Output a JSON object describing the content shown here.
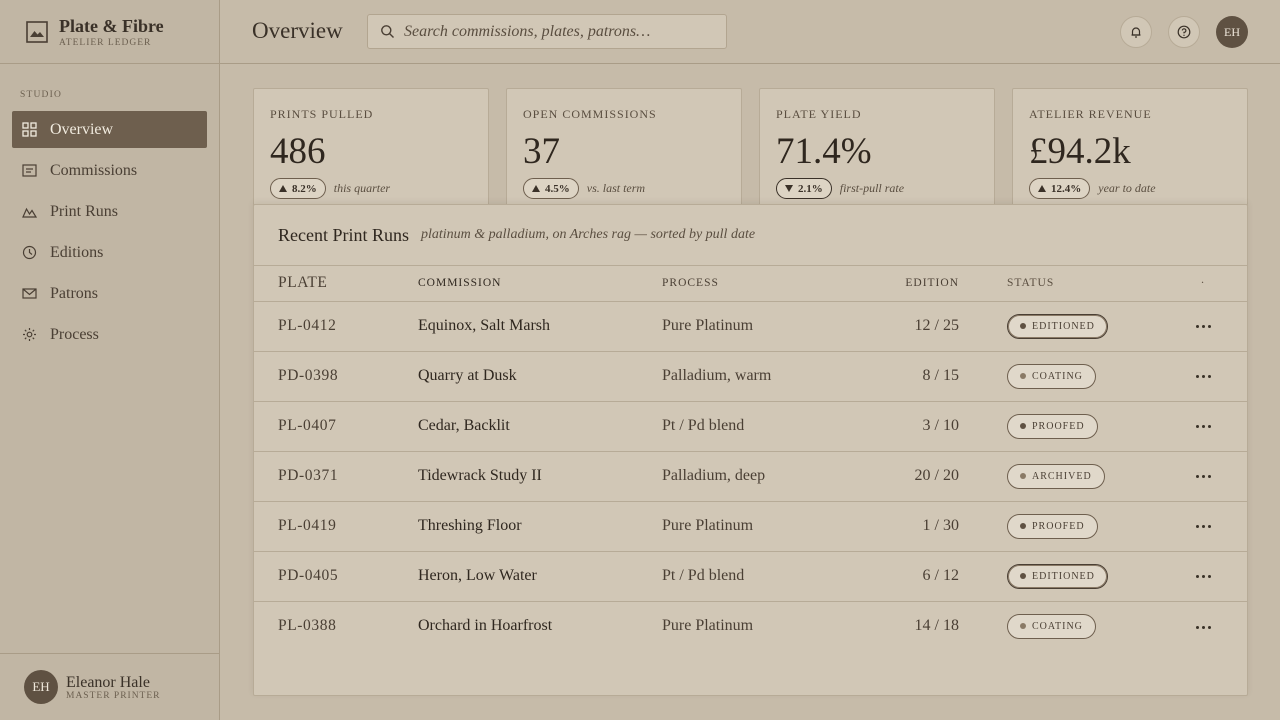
{
  "brand": {
    "name": "Plate & Fibre",
    "subtitle": "ATELIER LEDGER"
  },
  "sidebar": {
    "section_label": "STUDIO",
    "items": [
      {
        "label": "Overview",
        "icon": "grid-icon",
        "active": true
      },
      {
        "label": "Commissions",
        "icon": "list-doc-icon",
        "active": false
      },
      {
        "label": "Print Runs",
        "icon": "mountain-icon",
        "active": false
      },
      {
        "label": "Editions",
        "icon": "clock-icon",
        "active": false
      },
      {
        "label": "Patrons",
        "icon": "envelope-icon",
        "active": false
      },
      {
        "label": "Process",
        "icon": "gear-icon",
        "active": false
      }
    ]
  },
  "user": {
    "initials": "EH",
    "name": "Eleanor Hale",
    "role": "MASTER PRINTER"
  },
  "header": {
    "title": "Overview",
    "search_placeholder": "Search commissions, plates, patrons…",
    "avatar_initials": "EH"
  },
  "kpis": [
    {
      "label": "PRINTS PULLED",
      "value": "486",
      "delta": "8.2%",
      "direction": "up",
      "note": "this quarter"
    },
    {
      "label": "OPEN COMMISSIONS",
      "value": "37",
      "delta": "4.5%",
      "direction": "up",
      "note": "vs. last term"
    },
    {
      "label": "PLATE YIELD",
      "value": "71.4%",
      "delta": "2.1%",
      "direction": "down",
      "note": "first-pull rate"
    },
    {
      "label": "ATELIER REVENUE",
      "value": "£94.2k",
      "delta": "12.4%",
      "direction": "up",
      "note": "year to date"
    }
  ],
  "table": {
    "title": "Recent Print Runs",
    "subtitle": "platinum & palladium, on Arches rag — sorted by pull date",
    "columns": {
      "plate": "PLATE",
      "commission": "COMMISSION",
      "process": "PROCESS",
      "edition": "EDITION",
      "status": "STATUS",
      "more": "·"
    },
    "rows": [
      {
        "plate": "PL-0412",
        "commission": "Equinox, Salt Marsh",
        "process": "Pure Platinum",
        "edition": "12 / 25",
        "status": "EDITIONED"
      },
      {
        "plate": "PD-0398",
        "commission": "Quarry at Dusk",
        "process": "Palladium, warm",
        "edition": "8 / 15",
        "status": "COATING"
      },
      {
        "plate": "PL-0407",
        "commission": "Cedar, Backlit",
        "process": "Pt / Pd blend",
        "edition": "3 / 10",
        "status": "PROOFED"
      },
      {
        "plate": "PD-0371",
        "commission": "Tidewrack Study II",
        "process": "Palladium, deep",
        "edition": "20 / 20",
        "status": "ARCHIVED"
      },
      {
        "plate": "PL-0419",
        "commission": "Threshing Floor",
        "process": "Pure Platinum",
        "edition": "1 / 30",
        "status": "PROOFED"
      },
      {
        "plate": "PD-0405",
        "commission": "Heron, Low Water",
        "process": "Pt / Pd blend",
        "edition": "6 / 12",
        "status": "EDITIONED"
      },
      {
        "plate": "PL-0388",
        "commission": "Orchard in Hoarfrost",
        "process": "Pure Platinum",
        "edition": "14 / 18",
        "status": "COATING"
      }
    ]
  },
  "colors": {
    "background": "#c6bba9",
    "sidebar": "#c1b6a4",
    "card": "#d1c7b6",
    "accent": "#6e5f4e",
    "ink": "#3a3128"
  }
}
